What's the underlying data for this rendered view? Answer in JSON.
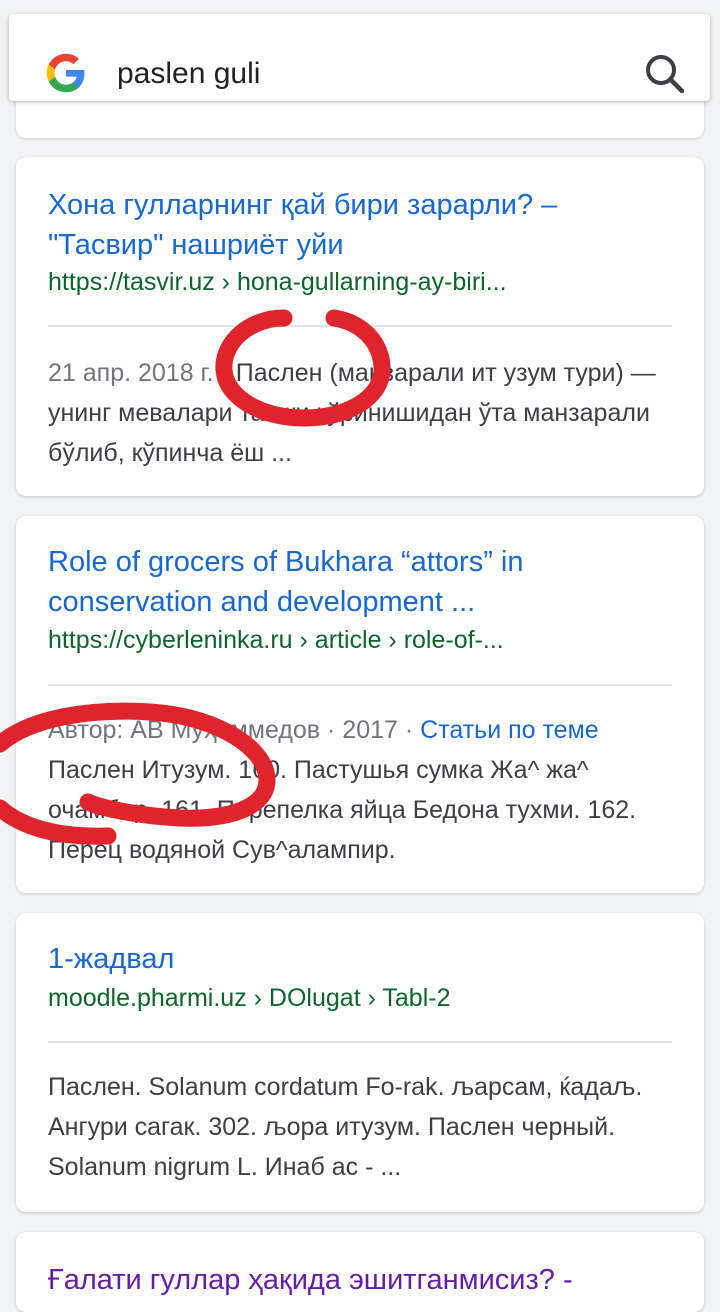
{
  "search": {
    "query": "paslen guli"
  },
  "icons": {
    "logo": "google-g-icon",
    "search": "search-icon"
  },
  "colors": {
    "link": "#1967d2",
    "url": "#0d652d",
    "visited": "#681da8",
    "scribble": "#e0242e"
  },
  "results": [
    {
      "title": "Хона гулларнинг қай бири зарарли? – \"Тасвир\" нашриёт уйи",
      "url": "https://tasvir.uz › hona-gullarning-ay-biri...",
      "meta": "21 апр. 2018 г. · ",
      "snippet": "Паслен (манзарали ит узум тури) — унинг мевалари ташқи кўринишидан ўта манзарали бўлиб, кўпинча ёш ..."
    },
    {
      "title": "Role of grocers of Bukhara “attors” in conservation and development ...",
      "url": "https://cyberleninka.ru › article › role-of-...",
      "meta": "Автор: АВ Муҳаммедов · 2017 · ",
      "meta_link": "Статьи по теме",
      "snippet": "Паслен Итузум. 160. Пастушья сумка Жа^ жа^ очамбир. 161. Перепелка яйца Бедона тухми. 162. Перец водяной Сув^алампир."
    },
    {
      "title": "1-жадвал",
      "url": "moodle.pharmi.uz › DOlugat › Tabl-2",
      "snippet": "Паслен. Solanum cordatum Fo-rak. љарсам, ќадаљ. Ангури сагак. 302. љора итузум. Паслен черный. Solanum nigrum L. Инаб ас - ..."
    },
    {
      "title": "Ғалати гуллар ҳақида эшитганмисиз? -"
    }
  ]
}
